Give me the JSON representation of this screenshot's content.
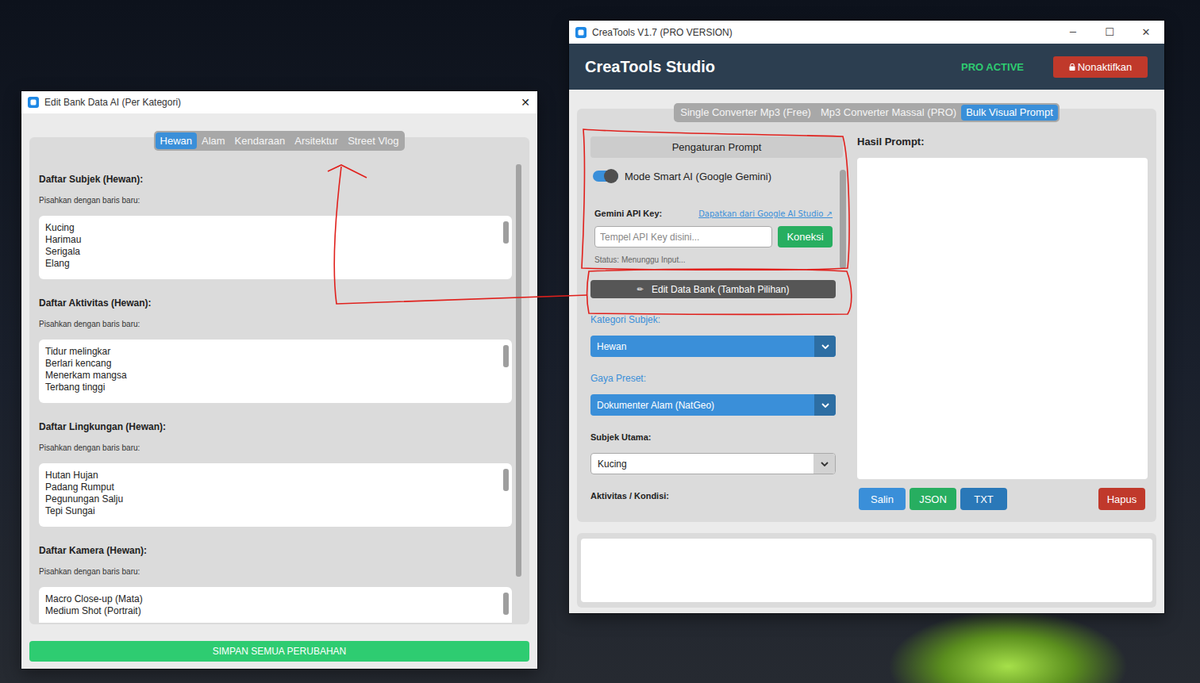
{
  "editor_window": {
    "title": "Edit Bank Data AI (Per Kategori)",
    "close": "✕",
    "tabs": [
      {
        "label": "Hewan",
        "selected": true
      },
      {
        "label": "Alam",
        "selected": false
      },
      {
        "label": "Kendaraan",
        "selected": false
      },
      {
        "label": "Arsitektur",
        "selected": false
      },
      {
        "label": "Street Vlog",
        "selected": false
      }
    ],
    "sections": [
      {
        "heading": "Daftar Subjek (Hewan):",
        "hint": "Pisahkan dengan baris baru:",
        "lines": [
          "Kucing",
          "Harimau",
          "Serigala",
          "Elang"
        ],
        "thumb": 0.42
      },
      {
        "heading": "Daftar Aktivitas (Hewan):",
        "hint": "Pisahkan dengan baris baru:",
        "lines": [
          "Tidur melingkar",
          "Berlari kencang",
          "Menerkam mangsa",
          "Terbang tinggi"
        ],
        "thumb": 0.42
      },
      {
        "heading": "Daftar Lingkungan (Hewan):",
        "hint": "Pisahkan dengan baris baru:",
        "lines": [
          "Hutan Hujan",
          "Padang Rumput",
          "Pegunungan Salju",
          "Tepi Sungai"
        ],
        "thumb": 0.42
      },
      {
        "heading": "Daftar Kamera (Hewan):",
        "hint": "Pisahkan dengan baris baru:",
        "lines": [
          "Macro Close-up (Mata)",
          "Medium Shot (Portrait)"
        ],
        "thumb": 0.42
      }
    ],
    "scroll_thumb": 0.9,
    "save_button": "SIMPAN SEMUA PERUBAHAN"
  },
  "main_window": {
    "title": "CreaTools V1.7 (PRO VERSION)",
    "controls": [
      "─",
      "☐",
      "✕"
    ],
    "app_name": "CreaTools Studio",
    "license_status": "PRO ACTIVE",
    "deactivate_button": "Nonaktifkan",
    "tabs": [
      {
        "label": "Single Converter Mp3 (Free)",
        "selected": false
      },
      {
        "label": "Mp3 Converter Massal (PRO)",
        "selected": false
      },
      {
        "label": "Bulk Visual Prompt",
        "selected": true
      }
    ],
    "settings": {
      "heading": "Pengaturan Prompt",
      "smart_ai": {
        "label": "Mode Smart AI (Google Gemini)",
        "on": true
      },
      "api_key_label": "Gemini API Key:",
      "api_key_link": "Dapatkan dari Google AI Studio ↗",
      "api_key": {
        "placeholder": "Tempel API Key disini...",
        "value": ""
      },
      "connect_button": "Koneksi",
      "status": "Status: Menunggu Input...",
      "scroll_thumb": 0.89
    },
    "edit_button": {
      "icon": "✏",
      "label": "Edit Data Bank (Tambah Pilihan)"
    },
    "fields": [
      {
        "label": "Kategori Subjek:",
        "value": "Hewan",
        "kind": "dropdown"
      },
      {
        "label": "Gaya Preset:",
        "value": "Dokumenter Alam (NatGeo)",
        "kind": "dropdown"
      },
      {
        "label": "Subjek Utama:",
        "value": "Kucing",
        "kind": "combobox"
      }
    ],
    "activity_label": "Aktivitas / Kondisi:",
    "result": {
      "label": "Hasil Prompt:",
      "text": ""
    },
    "result_buttons": [
      {
        "label": "Salin",
        "color": "#3a8fd9"
      },
      {
        "label": "JSON",
        "color": "#27ae60"
      },
      {
        "label": "TXT",
        "color": "#2a78b8"
      },
      {
        "label": "Hapus",
        "color": "#c0392b"
      }
    ]
  }
}
